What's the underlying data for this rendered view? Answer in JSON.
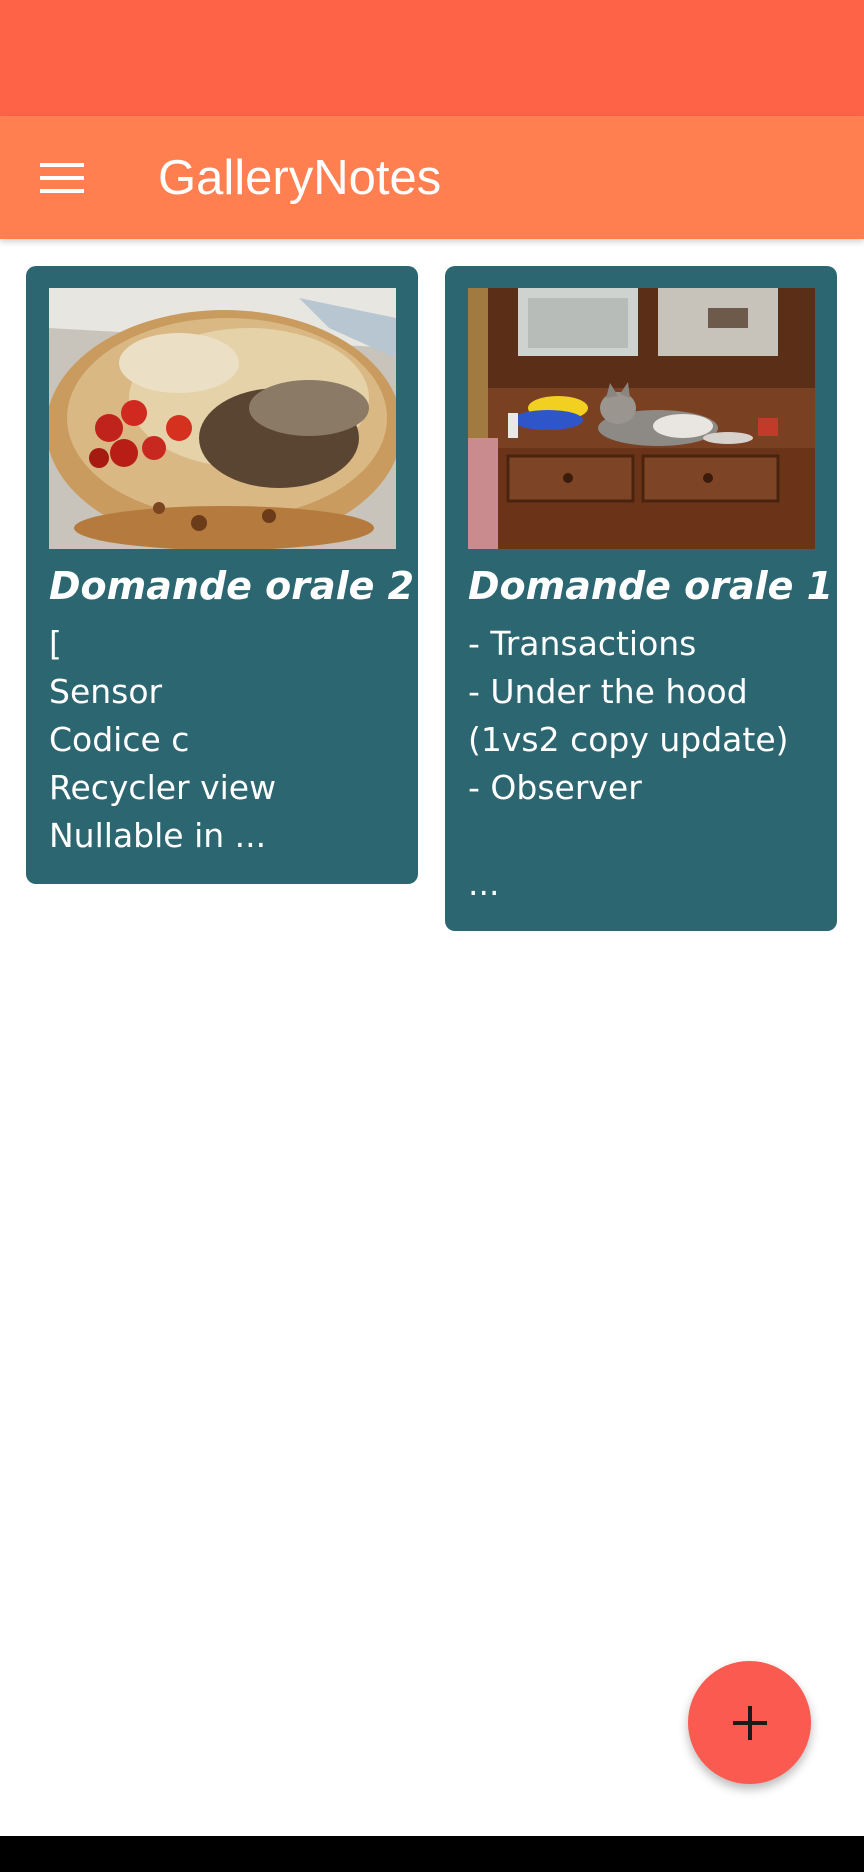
{
  "app_bar": {
    "title": "GalleryNotes",
    "menu_icon": "hamburger-menu-icon"
  },
  "colors": {
    "status_bar": "#ff6347",
    "app_bar": "#ff7f50",
    "card": "#2c6670",
    "fab": "#fa5a4f"
  },
  "notes": [
    {
      "title": "Domande orale 2",
      "body": "[\nSensor\nCodice c\nRecycler view\nNullable in ...",
      "image": "pizza-photo"
    },
    {
      "title": "Domande orale 1",
      "body": "- Transactions\n- Under the hood\n(1vs2 copy update)\n- Observer\n\n...",
      "image": "cat-on-cabinet-photo"
    }
  ],
  "fab": {
    "icon": "plus-icon"
  }
}
